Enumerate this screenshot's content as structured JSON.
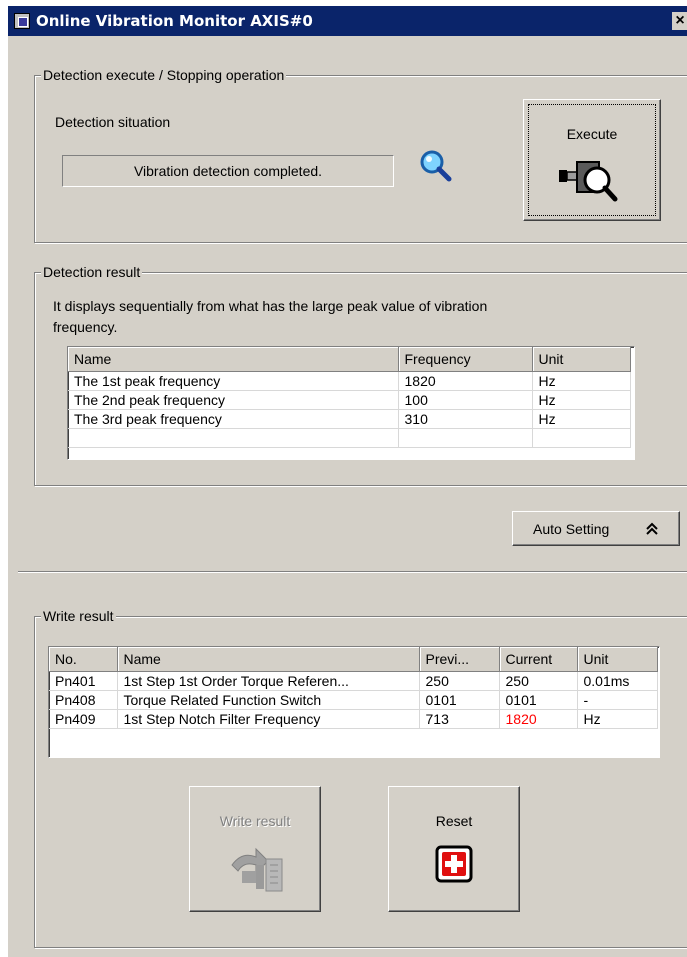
{
  "window": {
    "title": "Online Vibration Monitor AXIS#0",
    "close_glyph": "×"
  },
  "detection": {
    "legend": "Detection execute / Stopping operation",
    "situation_label": "Detection situation",
    "status_text": "Vibration detection completed.",
    "status_icon": "magnifier-icon",
    "execute_label": "Execute",
    "execute_icon": "motor-magnifier-icon"
  },
  "result": {
    "legend": "Detection result",
    "description_line1": "It displays sequentially from what has the large peak value of vibration",
    "description_line2": "frequency.",
    "columns": [
      "Name",
      "Frequency",
      "Unit"
    ],
    "rows": [
      [
        "The 1st peak frequency",
        "1820",
        "Hz"
      ],
      [
        "The 2nd peak frequency",
        "100",
        "Hz"
      ],
      [
        "The 3rd peak frequency",
        "310",
        "Hz"
      ]
    ]
  },
  "auto_setting": {
    "label": "Auto Setting",
    "icon": "double-chevron-up-icon"
  },
  "write": {
    "legend": "Write result",
    "columns": [
      "No.",
      "Name",
      "Previ...",
      "Current",
      "Unit"
    ],
    "rows": [
      [
        "Pn401",
        "1st Step 1st Order Torque Referen...",
        "250",
        "250",
        "0.01ms"
      ],
      [
        "Pn408",
        "Torque Related Function Switch",
        "0101",
        "0101",
        "-"
      ],
      [
        "Pn409",
        "1st Step Notch Filter Frequency",
        "713",
        "1820",
        "Hz"
      ]
    ],
    "highlight_color": "#ff0000",
    "write_button_label": "Write result",
    "write_button_enabled": false,
    "reset_button_label": "Reset",
    "reset_icon": "red-cross-icon"
  }
}
